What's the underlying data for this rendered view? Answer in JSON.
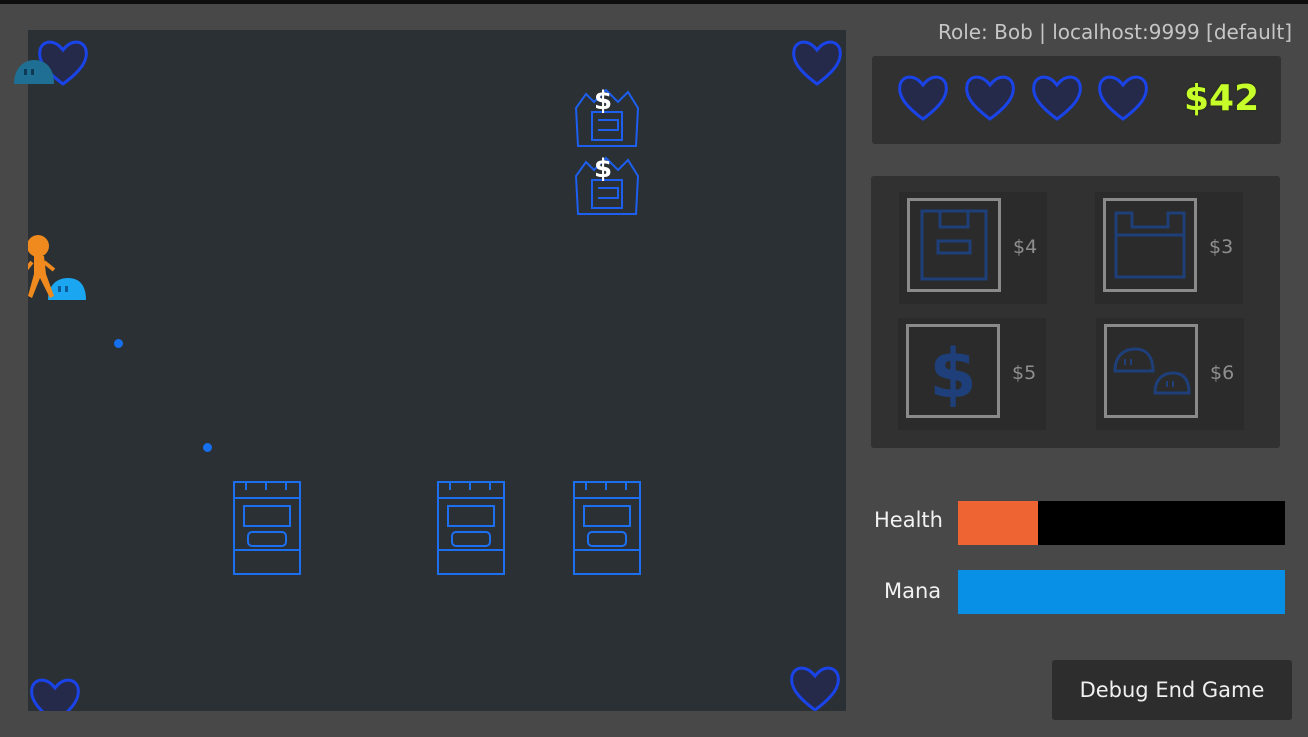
{
  "status": {
    "role_line": "Role: Bob | localhost:9999 [default]"
  },
  "hud": {
    "lives": [
      "heart-icon",
      "heart-icon",
      "heart-icon",
      "heart-icon"
    ],
    "money": "$42",
    "money_color": "#c7ff2a"
  },
  "shop": {
    "items": [
      {
        "icon": "wall-tower-icon",
        "price": "$4"
      },
      {
        "icon": "open-crate-tower-icon",
        "price": "$3"
      },
      {
        "icon": "dollar-icon",
        "price": "$5"
      },
      {
        "icon": "slime-pair-icon",
        "price": "$6"
      }
    ]
  },
  "stats": {
    "health_label": "Health",
    "health_fraction": 0.245,
    "health_color": "#ee6533",
    "mana_label": "Mana",
    "mana_fraction": 1.0,
    "mana_color": "#0890e6"
  },
  "board": {
    "money_tower_symbol": "$"
  },
  "debug_button": "Debug End Game"
}
